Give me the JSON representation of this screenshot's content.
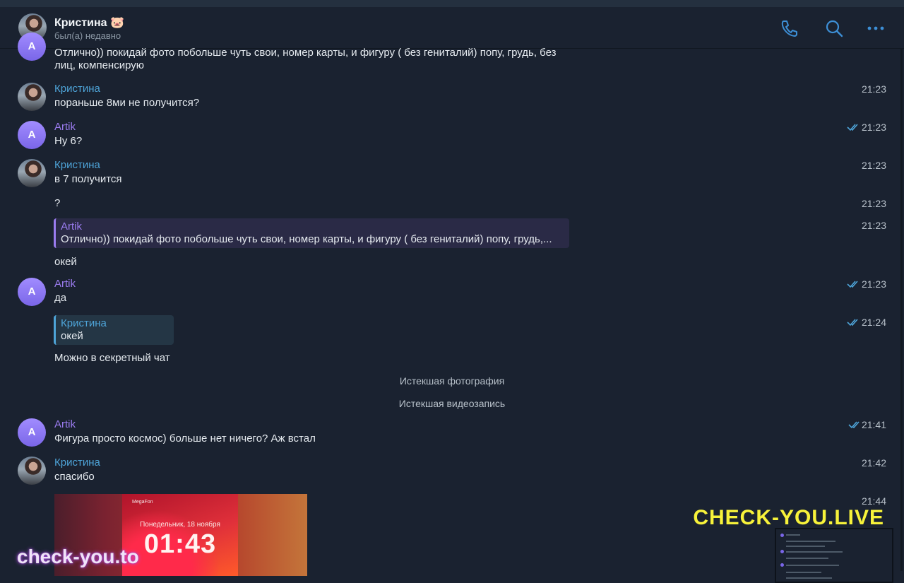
{
  "header": {
    "name": "Кристина 🐷",
    "status": "был(а) недавно",
    "icons": [
      "phone-icon",
      "search-icon",
      "more-icon"
    ]
  },
  "messages": {
    "m0_text_line1": "Отлично)) покидай фото побольше чуть свои, номер карты, и фигуру ( без гениталий) попу, грудь, без",
    "m0_text_line2": "лиц, компенсирую",
    "m1_name": "Кристина",
    "m1_text": "пораньше 8ми не получится?",
    "m1_time": "21:23",
    "m2_name": "Artik",
    "m2_text": "Ну 6?",
    "m2_time": "21:23",
    "m3_name": "Кристина",
    "m3_text": "в 7 получится",
    "m3_time": "21:23",
    "m4_text": "?",
    "m4_time": "21:23",
    "m5_quote_name": "Artik",
    "m5_quote_text": "Отлично)) покидай фото побольше чуть свои, номер карты, и фигуру ( без гениталий) попу, грудь,...",
    "m5_text": "окей",
    "m5_time": "21:23",
    "m6_name": "Artik",
    "m6_text": "да",
    "m6_time": "21:23",
    "m7_quote_name": "Кристина",
    "m7_quote_text": "окей",
    "m7_text": "Можно в секретный чат",
    "m7_time": "21:24",
    "service1": "Истекшая фотография",
    "service2": "Истекшая видеозапись",
    "m8_name": "Artik",
    "m8_text": "Фигура просто космос) больше нет ничего? Аж встал",
    "m8_time": "21:41",
    "m9_name": "Кристина",
    "m9_text": "спасибо",
    "m9_time": "21:42",
    "m10_time": "21:44"
  },
  "avatar_letter": "A",
  "photo": {
    "carrier": "MegaFon",
    "date": "Понедельник, 18 ноября",
    "time": "01:43"
  },
  "watermarks": {
    "left": "check-you.to",
    "right": "CHECK-YOU.LIVE"
  },
  "colors": {
    "background": "#1a2230",
    "kristina_name": "#4ea4d8",
    "artik_name": "#9b7cf0",
    "read_check": "#4ea4d8",
    "accent_icon": "#3d8fd6"
  }
}
